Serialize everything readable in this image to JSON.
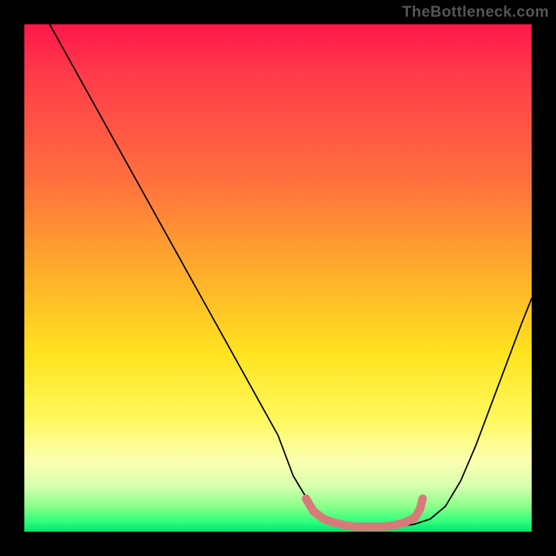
{
  "watermark": "TheBottleneck.com",
  "chart_data": {
    "type": "line",
    "title": "",
    "xlabel": "",
    "ylabel": "",
    "xlim": [
      0,
      100
    ],
    "ylim": [
      0,
      100
    ],
    "grid": false,
    "legend": false,
    "series": [
      {
        "name": "bottleneck-curve",
        "x": [
          5,
          10,
          15,
          20,
          25,
          30,
          35,
          40,
          45,
          50,
          53,
          56,
          59,
          62,
          65,
          68,
          71,
          74,
          77,
          80,
          83,
          86,
          89,
          92,
          95,
          98,
          100
        ],
        "values": [
          100,
          91,
          82,
          73,
          64,
          55,
          46,
          37,
          28,
          19,
          11,
          6,
          3,
          1.5,
          1,
          1,
          1,
          1,
          1.5,
          2.5,
          5,
          10,
          17,
          25,
          33,
          41,
          46
        ]
      }
    ],
    "trough_marker": {
      "name": "optimal-band",
      "color": "#d97a7a",
      "x": [
        55.5,
        57,
        59,
        61,
        63,
        65,
        67,
        69,
        71,
        73,
        75,
        77,
        78,
        78.5
      ],
      "values": [
        6.5,
        4,
        2.5,
        1.8,
        1.3,
        1,
        1,
        1,
        1,
        1.3,
        1.8,
        2.8,
        4.5,
        6.5
      ]
    },
    "gradient_stops": [
      {
        "pos": 0,
        "color": "#ff1749"
      },
      {
        "pos": 10,
        "color": "#ff3b4a"
      },
      {
        "pos": 30,
        "color": "#ff6e3f"
      },
      {
        "pos": 50,
        "color": "#ffb12a"
      },
      {
        "pos": 65,
        "color": "#ffe31f"
      },
      {
        "pos": 78,
        "color": "#fff95f"
      },
      {
        "pos": 86,
        "color": "#fcffb0"
      },
      {
        "pos": 91,
        "color": "#d7ffb0"
      },
      {
        "pos": 95,
        "color": "#8aff8a"
      },
      {
        "pos": 98,
        "color": "#2fff7d"
      },
      {
        "pos": 100,
        "color": "#00e56a"
      }
    ]
  }
}
